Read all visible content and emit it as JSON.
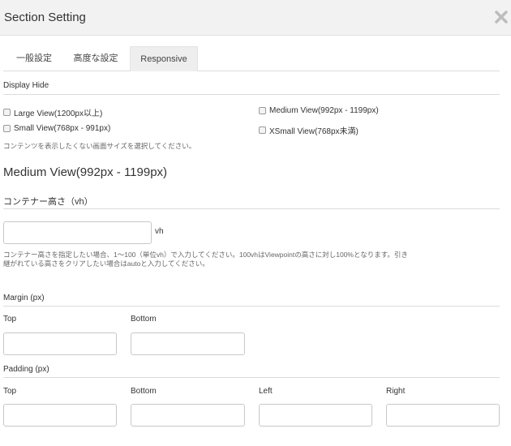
{
  "dialog": {
    "title": "Section Setting"
  },
  "tabs": [
    {
      "label": "一般設定"
    },
    {
      "label": "高度な設定"
    },
    {
      "label": "Responsive",
      "active": true
    }
  ],
  "display_hide": {
    "heading": "Display Hide",
    "options": [
      {
        "label": "Large View(1200px以上)",
        "checked": false
      },
      {
        "label": "Medium View(992px - 1199px)",
        "checked": false
      },
      {
        "label": "Small View(768px - 991px)",
        "checked": false
      },
      {
        "label": "XSmall View(768px未満)",
        "checked": false
      }
    ],
    "help": "コンテンツを表示したくない画面サイズを選択してください。"
  },
  "view_heading": "Medium View(992px - 1199px)",
  "container_height": {
    "heading": "コンテナー高さ（vh）",
    "value": "",
    "unit": "vh",
    "help_line1": "コンテナー高さを指定したい場合、1～100（単位vh）で入力してください。100vhはViewpointの高さに対し100%となります。引き",
    "help_line2": "継がれている高さをクリアしたい場合はautoと入力してください。"
  },
  "margin": {
    "heading": "Margin (px)",
    "top_label": "Top",
    "bottom_label": "Bottom",
    "top_value": "",
    "bottom_value": ""
  },
  "padding": {
    "heading": "Padding (px)",
    "top_label": "Top",
    "bottom_label": "Bottom",
    "left_label": "Left",
    "right_label": "Right",
    "top_value": "",
    "bottom_value": "",
    "left_value": "",
    "right_value": ""
  },
  "icons": {
    "close": "close-icon"
  }
}
